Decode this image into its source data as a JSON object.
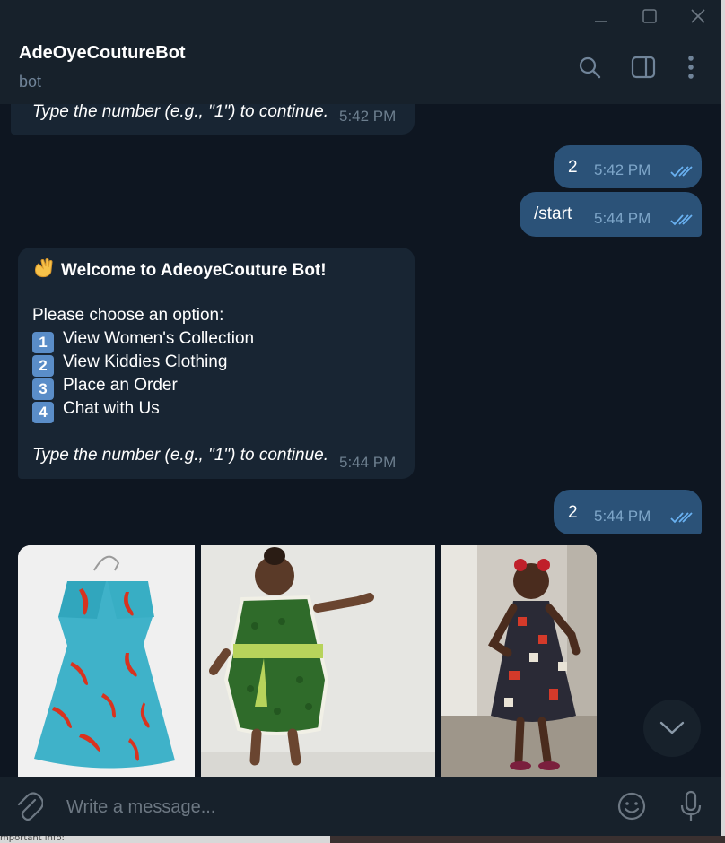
{
  "window": {
    "minimize_icon": "minimize-icon",
    "maximize_icon": "maximize-icon",
    "close_icon": "close-icon"
  },
  "header": {
    "title": "AdeOyeCoutureBot",
    "subtitle": "bot",
    "icons": [
      "search-icon",
      "sidebar-toggle-icon",
      "more-vertical-icon"
    ]
  },
  "messages": {
    "m0": {
      "text": "Type the number (e.g., \"1\") to continue.",
      "time": "5:42 PM"
    },
    "m1": {
      "text": "2",
      "time": "5:42 PM"
    },
    "m2": {
      "text": "/start",
      "time": "5:44 PM"
    },
    "m3": {
      "heading": "Welcome to AdeoyeCouture Bot!",
      "prompt": "Please choose an option:",
      "options": [
        {
          "num": "1",
          "label": "View Women's Collection"
        },
        {
          "num": "2",
          "label": "View Kiddies Clothing"
        },
        {
          "num": "3",
          "label": "Place an Order"
        },
        {
          "num": "4",
          "label": "Chat with Us"
        }
      ],
      "footer": "Type the number (e.g., \"1\") to continue.",
      "time": "5:44 PM"
    },
    "m4": {
      "text": "2",
      "time": "5:44 PM"
    }
  },
  "photos": [
    {
      "subject": "Turquoise dress with red chili pepper print on hanger"
    },
    {
      "subject": "Child in green print kaftan with lime sash"
    },
    {
      "subject": "Girl in multi-print ankara sundress"
    }
  ],
  "composer": {
    "placeholder": "Write a message...",
    "icons": [
      "attach-icon",
      "emoji-icon",
      "microphone-icon"
    ]
  },
  "background_fragment": "mportant info:",
  "colors": {
    "chat_bg": "#0e1621",
    "panel": "#17212b",
    "incoming": "#182533",
    "outgoing": "#2b5278",
    "accent": "#6ab2f2"
  }
}
